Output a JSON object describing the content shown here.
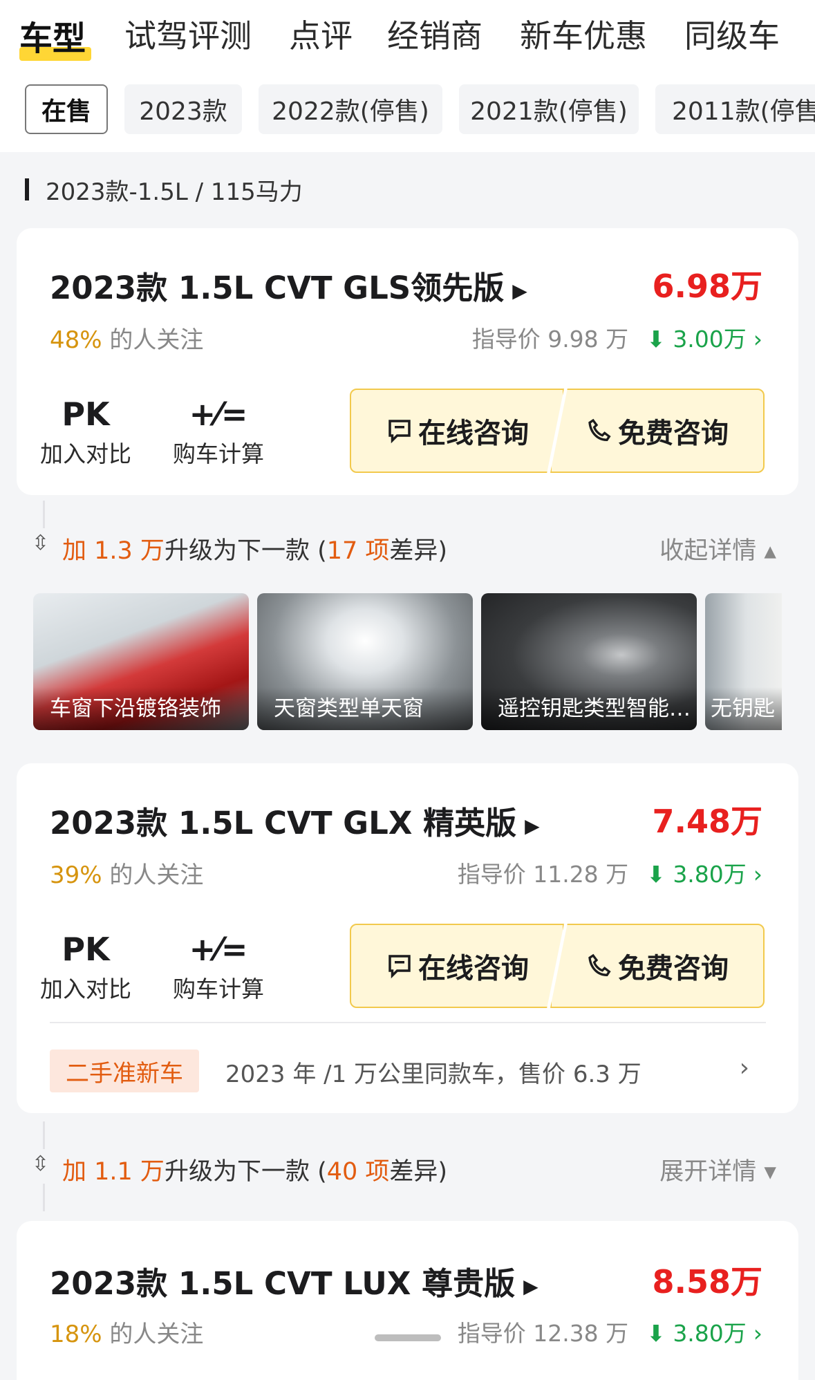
{
  "nav": {
    "tabs": [
      "车型",
      "试驾评测",
      "点评",
      "经销商",
      "新车优惠",
      "同级车"
    ],
    "active_index": 0
  },
  "year_filters": [
    "在售",
    "2023款",
    "2022款(停售)",
    "2021款(停售)",
    "2011款(停售"
  ],
  "section": {
    "title": "2023款-1.5L / 115马力"
  },
  "trims": [
    {
      "name": "2023款 1.5L CVT GLS领先版",
      "price": "6.98万",
      "attention_pct": "48%",
      "attention_text": "的人关注",
      "guide_price": "指导价 9.98 万",
      "drop": "3.00万"
    },
    {
      "name": "2023款 1.5L CVT GLX 精英版",
      "price": "7.48万",
      "attention_pct": "39%",
      "attention_text": "的人关注",
      "guide_price": "指导价 11.28 万",
      "drop": "3.80万"
    },
    {
      "name": "2023款 1.5L CVT LUX 尊贵版",
      "price": "8.58万",
      "attention_pct": "18%",
      "attention_text": "的人关注",
      "guide_price": "指导价 12.38 万",
      "drop": "3.80万"
    }
  ],
  "tools": {
    "pk_icon": "PK",
    "pk_label": "加入对比",
    "calc_icon": "+⁄=",
    "calc_label": "购车计算"
  },
  "consult": {
    "online": "在线咨询",
    "free": "免费咨询"
  },
  "upgrades": [
    {
      "prefix": "加 ",
      "amount": "1.3 万",
      "middle": "升级为下一款 (",
      "count": "17 项",
      "suffix": "差异)",
      "toggle": "收起详情 ▴"
    },
    {
      "prefix": "加 ",
      "amount": "1.1 万",
      "middle": "升级为下一款 (",
      "count": "40 项",
      "suffix": "差异)",
      "toggle": "展开详情 ▾"
    }
  ],
  "feature_thumbs": [
    "车窗下沿镀铬装饰",
    "天窗类型单天窗",
    "遥控钥匙类型智能…",
    "无钥匙"
  ],
  "used_car": {
    "tag": "二手准新车",
    "desc": "2023 年 /1 万公里同款车，售价 6.3 万",
    "arrow": "›"
  },
  "colors": {
    "price_red": "#e8201f",
    "drop_green": "#1aa34a",
    "accent_orange": "#e25c10",
    "tab_yellow": "#ffd21f",
    "consult_bg": "#fff7d9"
  }
}
